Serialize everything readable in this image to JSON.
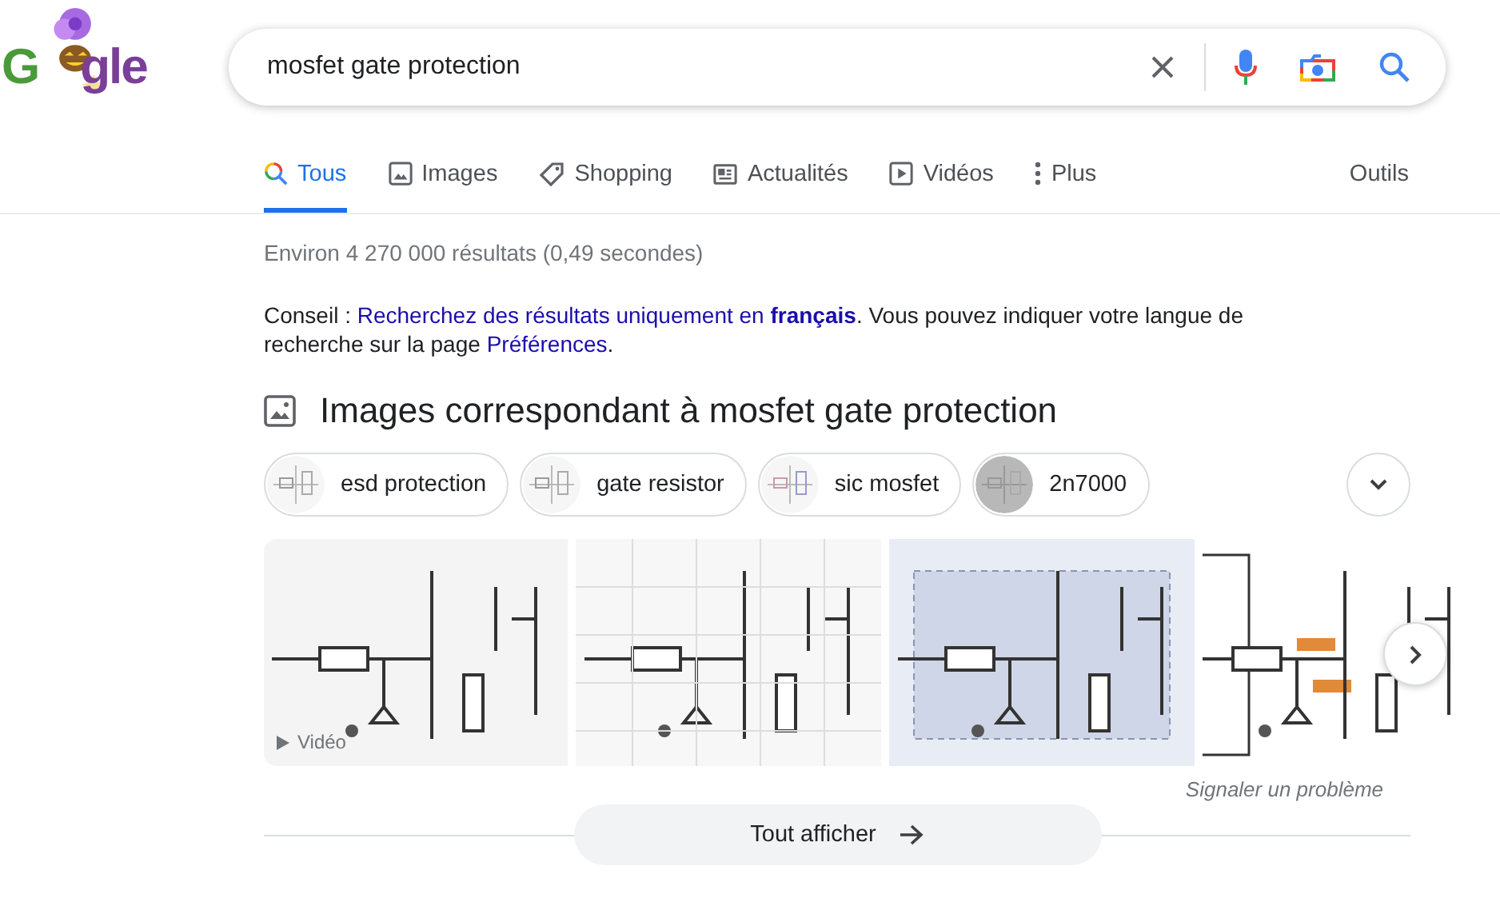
{
  "logo": {
    "parts": [
      "G",
      "gle"
    ]
  },
  "search": {
    "value": "mosfet gate protection"
  },
  "tabs": [
    {
      "label": "Tous",
      "kind": "all",
      "selected": true
    },
    {
      "label": "Images",
      "kind": "images",
      "selected": false
    },
    {
      "label": "Shopping",
      "kind": "shopping",
      "selected": false
    },
    {
      "label": "Actualités",
      "kind": "news",
      "selected": false
    },
    {
      "label": "Vidéos",
      "kind": "videos",
      "selected": false
    },
    {
      "label": "Plus",
      "kind": "more",
      "selected": false
    }
  ],
  "tools": "Outils",
  "stats": "Environ 4 270 000 résultats (0,49 secondes)",
  "tip": {
    "prefix": "Conseil : ",
    "link": "Recherchez des résultats uniquement en **français**",
    "middle": ". Vous pouvez indiquer votre langue de recherche sur la page ",
    "link2": "Préférences",
    "suffix": "."
  },
  "images_heading": "Images correspondant à mosfet gate protection",
  "chips": [
    {
      "label": "esd protection"
    },
    {
      "label": "gate resistor"
    },
    {
      "label": "sic mosfet"
    },
    {
      "label": "2n7000"
    }
  ],
  "images": [
    {
      "kind": "picture",
      "badge": "Vidéo"
    },
    {
      "kind": "picture"
    },
    {
      "kind": "picture"
    },
    {
      "kind": "picture"
    }
  ],
  "report": "Signaler un problème",
  "show_all": "Tout afficher"
}
